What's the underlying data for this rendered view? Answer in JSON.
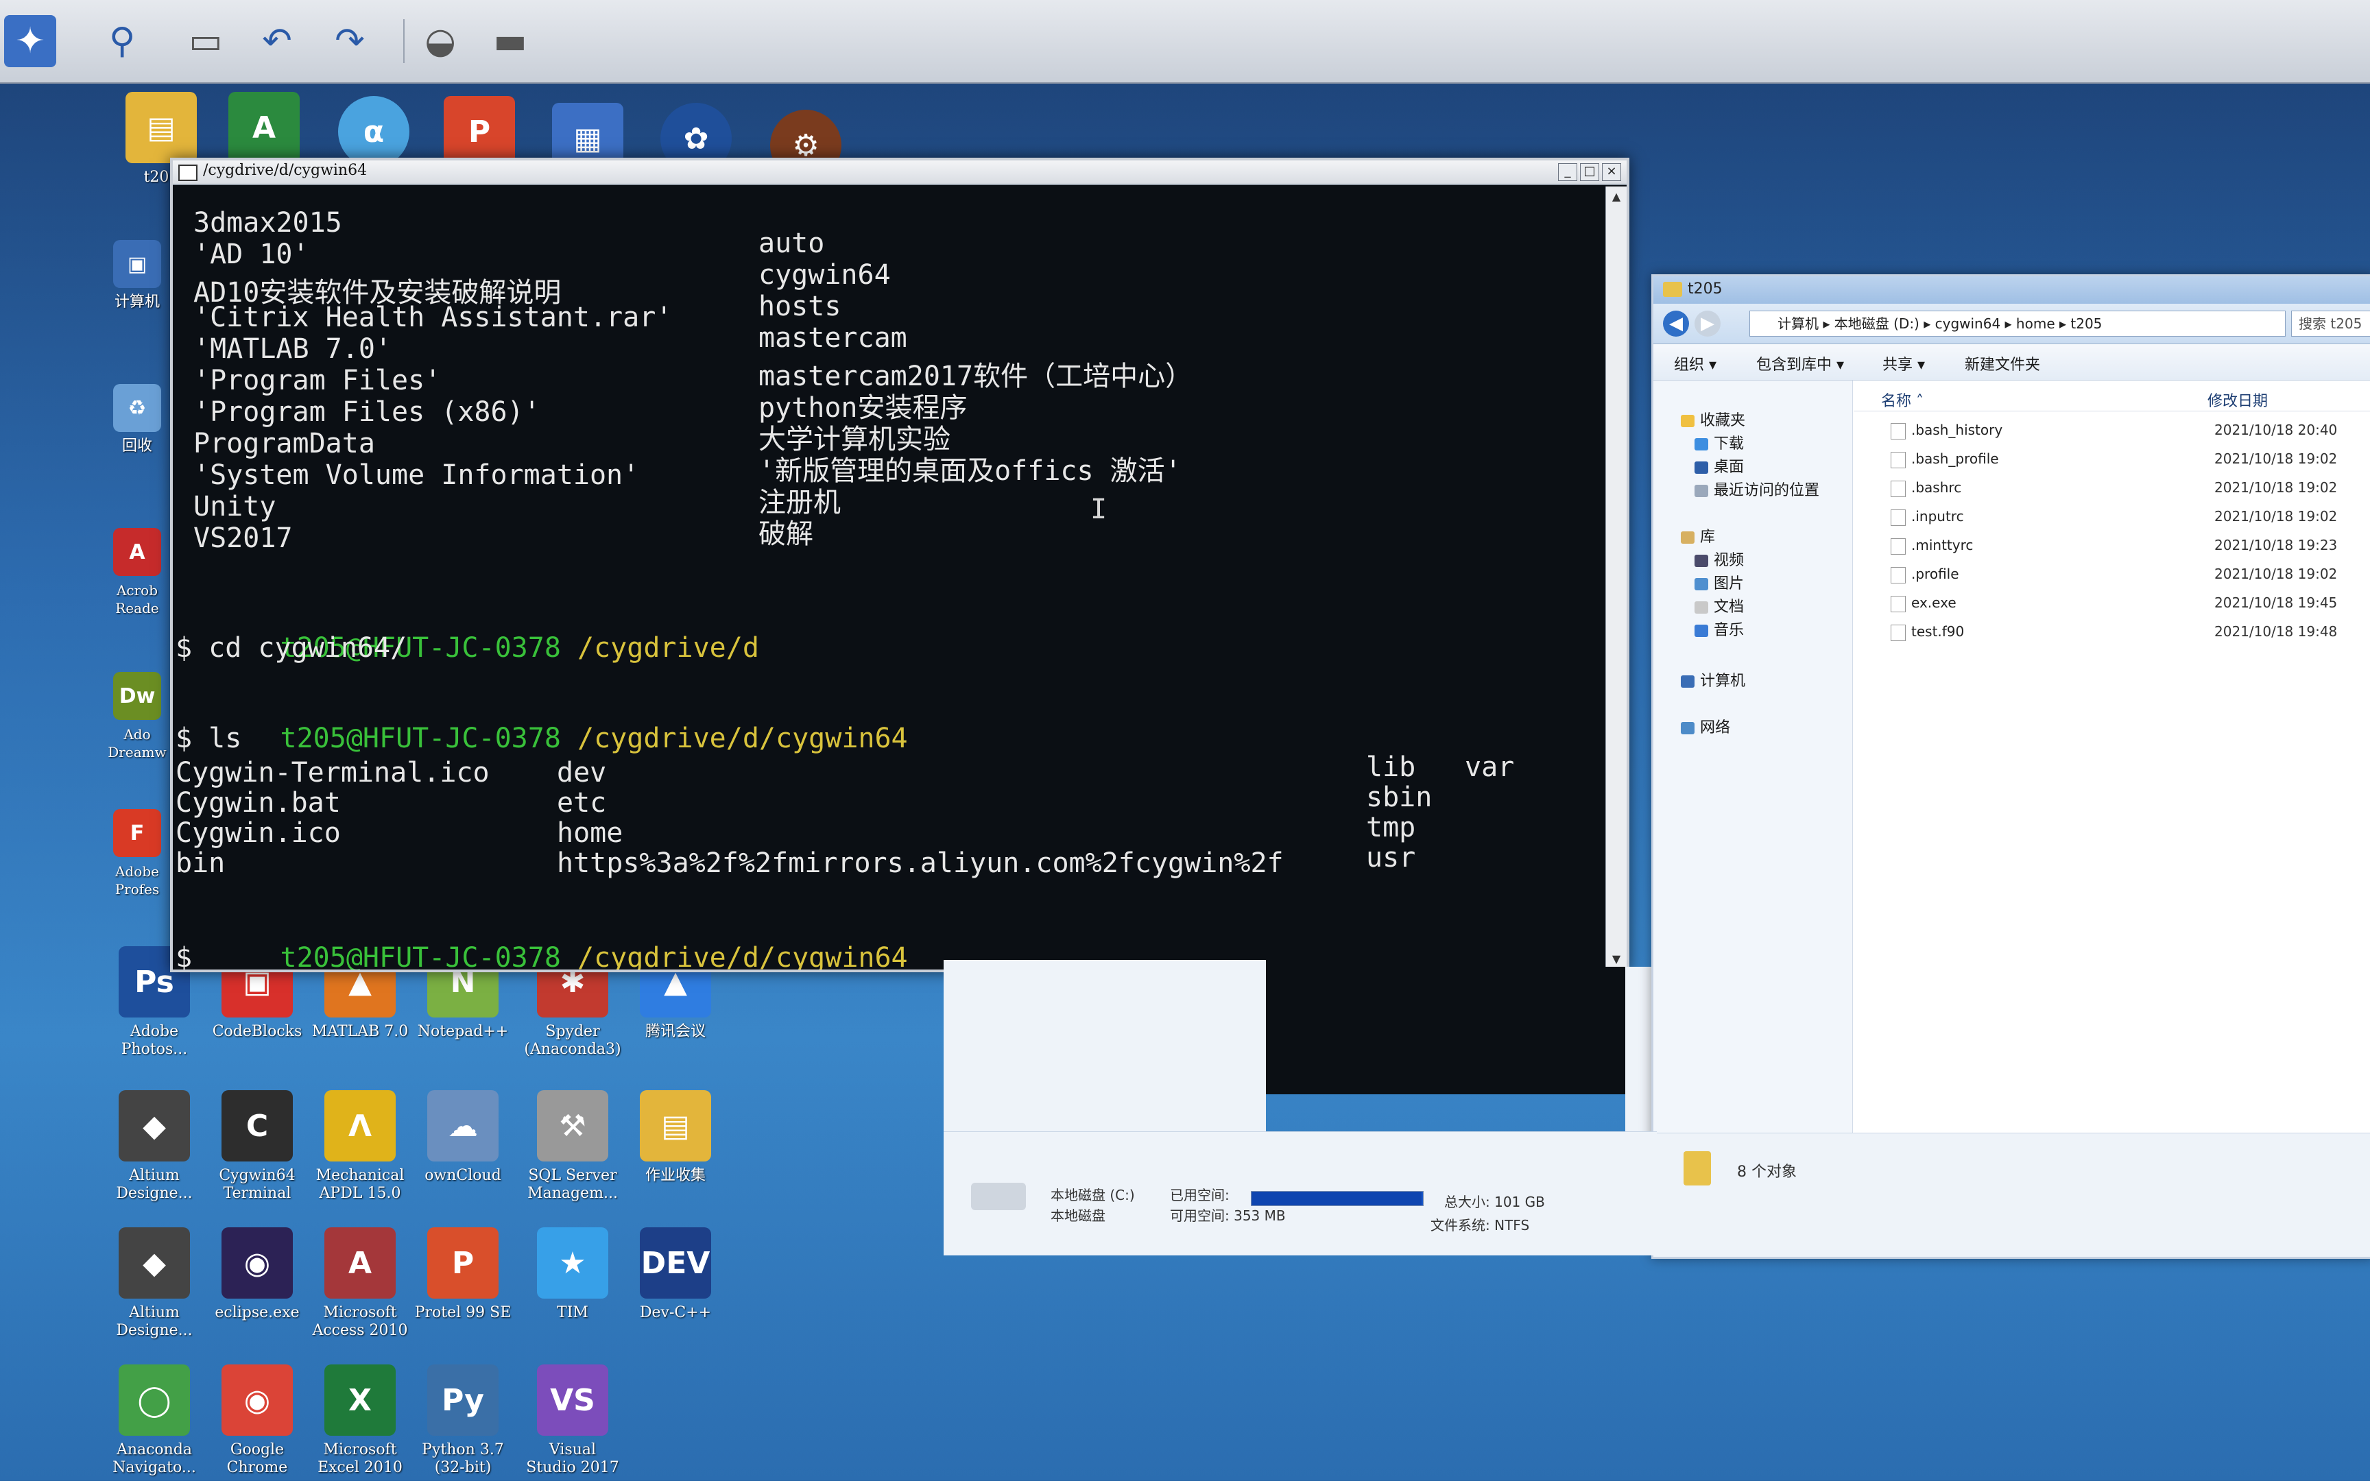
{
  "toolbar": {
    "items": [
      "remote-logo",
      "zoom",
      "window",
      "undo",
      "redo",
      "camera",
      "monitor"
    ]
  },
  "desktop": {
    "top_icons": [
      {
        "name": "t205-folder",
        "label": "t205",
        "color": "#e3b53b"
      },
      {
        "name": "app-a",
        "label": "",
        "color": "#2b8a3e"
      },
      {
        "name": "app-globe",
        "label": "",
        "color": "#4aa3df"
      },
      {
        "name": "app-p",
        "label": "",
        "color": "#d8452b"
      },
      {
        "name": "app-grid",
        "label": "",
        "color": "#3c6fc4"
      },
      {
        "name": "app-blue",
        "label": "",
        "color": "#1f4f9a"
      },
      {
        "name": "app-gear",
        "label": "",
        "color": "#7a3b1e"
      }
    ],
    "left_icons": [
      {
        "name": "computer",
        "label": "计算机",
        "color": "#3a6db5"
      },
      {
        "name": "recycle-bin",
        "label": "回收",
        "color": "#6aa0d6"
      },
      {
        "name": "acrobat",
        "label": "Acrob\nReade",
        "color": "#c62b2b"
      },
      {
        "name": "dreamweaver",
        "label": "Ado\nDreamw",
        "color": "#6b8e23"
      },
      {
        "name": "adobe-f",
        "label": "Adobe\nProfes",
        "color": "#d93a25"
      }
    ],
    "grid_icons": [
      [
        {
          "name": "photoshop",
          "text": "Ps",
          "label": "Adobe\nPhotos...",
          "color": "#1e4f9c"
        },
        {
          "name": "codeblocks",
          "text": "▣",
          "label": "CodeBlocks",
          "color": "#d8302b"
        },
        {
          "name": "matlab",
          "text": "▲",
          "label": "MATLAB 7.0",
          "color": "#e0751f"
        },
        {
          "name": "notepadpp",
          "text": "N",
          "label": "Notepad++",
          "color": "#7bb043"
        },
        {
          "name": "spyder",
          "text": "✱",
          "label": "Spyder\n(Anaconda3)",
          "color": "#c23a2f"
        },
        {
          "name": "tencent-meeting",
          "text": "▲",
          "label": "腾讯会议",
          "color": "#2f7de1"
        }
      ],
      [
        {
          "name": "altium-1",
          "text": "◆",
          "label": "Altium\nDesigne...",
          "color": "#444"
        },
        {
          "name": "cygwin-terminal",
          "text": "C",
          "label": "Cygwin64\nTerminal",
          "color": "#2d2d2d"
        },
        {
          "name": "mechanical-apdl",
          "text": "Λ",
          "label": "Mechanical\nAPDL 15.0",
          "color": "#e0b31a"
        },
        {
          "name": "owncloud",
          "text": "☁",
          "label": "ownCloud",
          "color": "#6a8fbf"
        },
        {
          "name": "sql-server",
          "text": "⚒",
          "label": "SQL Server\nManagem...",
          "color": "#999"
        },
        {
          "name": "homework-folder",
          "text": "▤",
          "label": "作业收集",
          "color": "#e3b53b"
        }
      ],
      [
        {
          "name": "altium-2",
          "text": "◆",
          "label": "Altium\nDesigne...",
          "color": "#444"
        },
        {
          "name": "eclipse",
          "text": "◉",
          "label": "eclipse.exe",
          "color": "#2c2255"
        },
        {
          "name": "access",
          "text": "A",
          "label": "Microsoft\nAccess 2010",
          "color": "#a4373a"
        },
        {
          "name": "protel",
          "text": "P",
          "label": "Protel 99 SE",
          "color": "#d94f2b"
        },
        {
          "name": "tim",
          "text": "★",
          "label": "TIM",
          "color": "#37a0e8"
        },
        {
          "name": "devcpp",
          "text": "DEV",
          "label": "Dev-C++",
          "color": "#1d3f88"
        }
      ],
      [
        {
          "name": "anaconda",
          "text": "◯",
          "label": "Anaconda\nNavigato...",
          "color": "#43a047"
        },
        {
          "name": "chrome",
          "text": "◉",
          "label": "Google\nChrome",
          "color": "#db4437"
        },
        {
          "name": "excel",
          "text": "X",
          "label": "Microsoft\nExcel 2010",
          "color": "#1f7a3a"
        },
        {
          "name": "python",
          "text": "Py",
          "label": "Python 3.7\n(32-bit)",
          "color": "#3a6fa7"
        },
        {
          "name": "visual-studio",
          "text": "VS",
          "label": "Visual\nStudio 2017",
          "color": "#7c4dbb"
        }
      ]
    ]
  },
  "terminal": {
    "title": "/cygdrive/d/cygwin64",
    "left_listing": [
      "3dmax2015",
      "'AD 10'",
      "AD10安装软件及安装破解说明",
      "'Citrix Health Assistant.rar'",
      "'MATLAB 7.0'",
      "'Program Files'",
      "'Program Files (x86)'",
      "ProgramData",
      "'System Volume Information'",
      "Unity",
      "VS2017"
    ],
    "right_listing": [
      "auto",
      "cygwin64",
      "hosts",
      "mastercam",
      "mastercam2017软件（工培中心）",
      "python安装程序",
      "大学计算机实验",
      "'新版管理的桌面及offics 激活'",
      "注册机",
      "破解"
    ],
    "prompt1_user": "t205@HFUT-JC-0378",
    "prompt1_path": "/cygdrive/d",
    "cmd1": "$ cd cygwin64/",
    "prompt2_user": "t205@HFUT-JC-0378",
    "prompt2_path": "/cygdrive/d/cygwin64",
    "cmd2": "$ ls",
    "ls_col1": [
      "Cygwin-Terminal.ico",
      "Cygwin.bat",
      "Cygwin.ico",
      "bin"
    ],
    "ls_col2": [
      "dev",
      "etc",
      "home",
      "https%3a%2f%2fmirrors.aliyun.com%2fcygwin%2f"
    ],
    "ls_col3": [
      "lib",
      "sbin",
      "tmp",
      "usr"
    ],
    "ls_col4": [
      "var"
    ],
    "prompt3_user": "t205@HFUT-JC-0378",
    "prompt3_path": "/cygdrive/d/cygwin64",
    "cursor_prompt": "$"
  },
  "explorer": {
    "title": "t205",
    "address": "计算机 ▸ 本地磁盘 (D:) ▸ cygwin64 ▸ home ▸ t205",
    "search_placeholder": "搜索 t205",
    "commands": [
      "组织 ▾",
      "包含到库中 ▾",
      "共享 ▾",
      "新建文件夹"
    ],
    "nav": {
      "favorites": "收藏夹",
      "fav_items": [
        "下载",
        "桌面",
        "最近访问的位置"
      ],
      "library": "库",
      "lib_items": [
        "视频",
        "图片",
        "文档",
        "音乐"
      ],
      "computer": "计算机",
      "network": "网络"
    },
    "columns": {
      "name": "名称",
      "date": "修改日期"
    },
    "files": [
      {
        "name": ".bash_history",
        "date": "2021/10/18 20:40"
      },
      {
        "name": ".bash_profile",
        "date": "2021/10/18 19:02"
      },
      {
        "name": ".bashrc",
        "date": "2021/10/18 19:02"
      },
      {
        "name": ".inputrc",
        "date": "2021/10/18 19:02"
      },
      {
        "name": ".minttyrc",
        "date": "2021/10/18 19:23"
      },
      {
        "name": ".profile",
        "date": "2021/10/18 19:02"
      },
      {
        "name": "ex.exe",
        "date": "2021/10/18 19:45"
      },
      {
        "name": "test.f90",
        "date": "2021/10/18 19:48"
      }
    ],
    "status": "8 个对象"
  },
  "drive": {
    "name": "本地磁盘 (C:)",
    "type": "本地磁盘",
    "used_label": "已用空间:",
    "free_label": "可用空间:",
    "free_value": "353 MB",
    "total_label": "总大小:",
    "total_value": "101 GB",
    "fs_label": "文件系统:",
    "fs_value": "NTFS",
    "used_fraction": 0.99
  }
}
